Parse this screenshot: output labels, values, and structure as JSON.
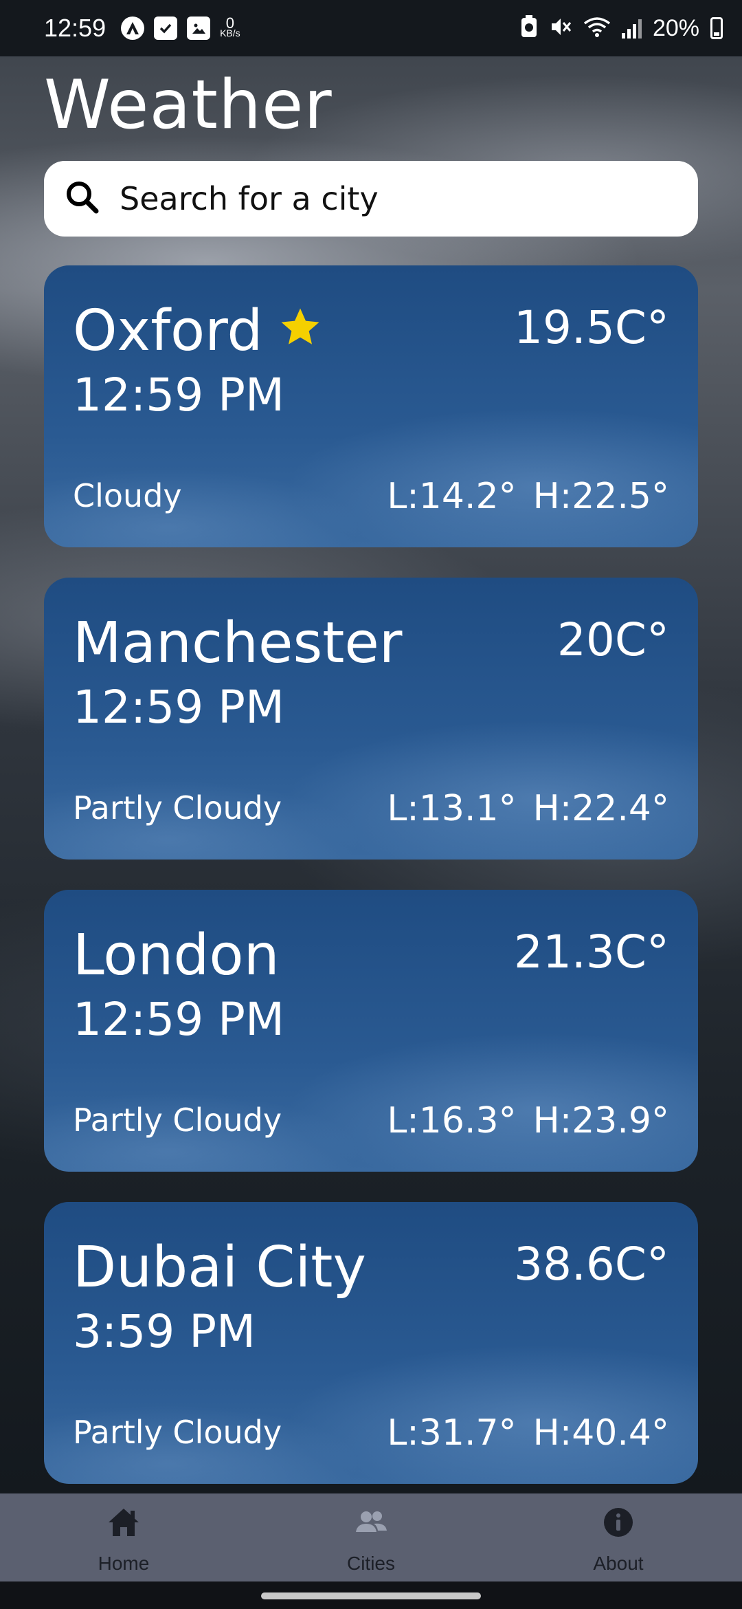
{
  "status_bar": {
    "time": "12:59",
    "net_speed_value": "0",
    "net_speed_unit": "KB/s",
    "battery": "20%"
  },
  "app": {
    "title": "Weather"
  },
  "search": {
    "placeholder": "Search for a city",
    "value": ""
  },
  "cities": [
    {
      "name": "Oxford",
      "favorite": true,
      "temp": "19.5C°",
      "time": "12:59 PM",
      "condition": "Cloudy",
      "low": "L:14.2°",
      "high": "H:22.5°"
    },
    {
      "name": "Manchester",
      "favorite": false,
      "temp": "20C°",
      "time": "12:59 PM",
      "condition": "Partly Cloudy",
      "low": "L:13.1°",
      "high": "H:22.4°"
    },
    {
      "name": "London",
      "favorite": false,
      "temp": "21.3C°",
      "time": "12:59 PM",
      "condition": "Partly Cloudy",
      "low": "L:16.3°",
      "high": "H:23.9°"
    },
    {
      "name": "Dubai City",
      "favorite": false,
      "temp": "38.6C°",
      "time": "3:59 PM",
      "condition": "Partly Cloudy",
      "low": "L:31.7°",
      "high": "H:40.4°"
    }
  ],
  "bottom_nav": {
    "items": [
      {
        "label": "Home",
        "icon": "home-icon"
      },
      {
        "label": "Cities",
        "icon": "people-icon"
      },
      {
        "label": "About",
        "icon": "info-icon"
      }
    ]
  },
  "colors": {
    "card": "#2a5a92",
    "star": "#f5d000",
    "nav_bar": "#5b6070"
  }
}
